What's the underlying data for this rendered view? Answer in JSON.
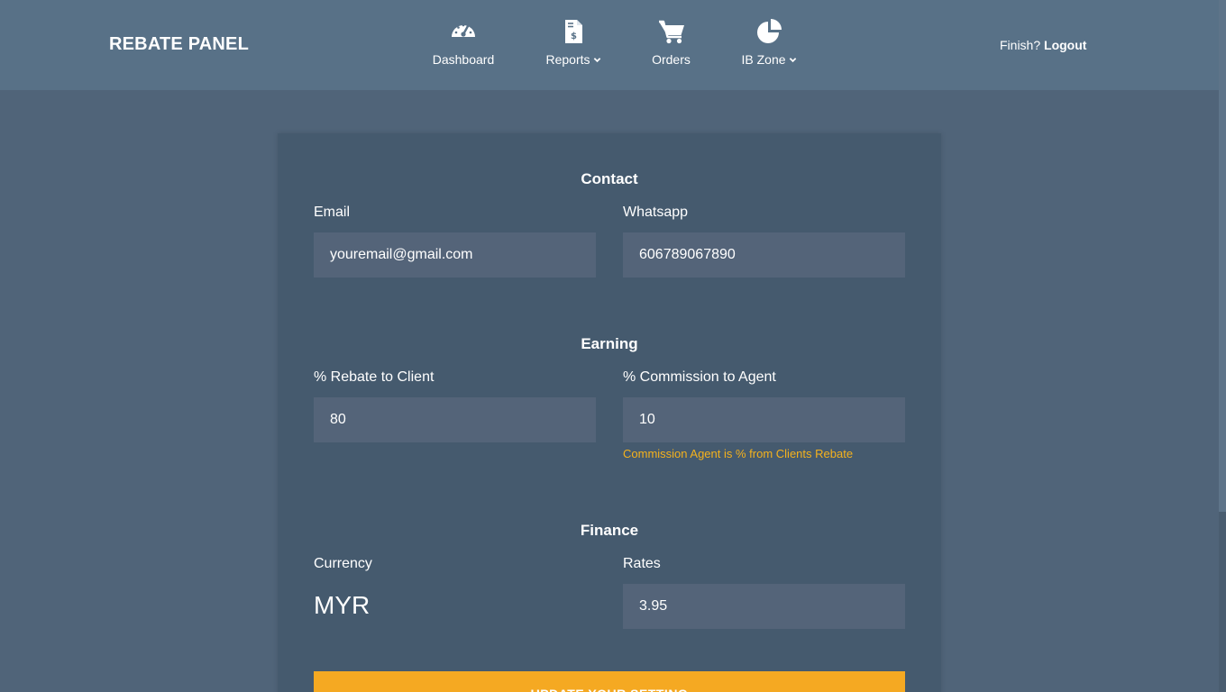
{
  "brand": "REBATE PANEL",
  "nav": {
    "dashboard": "Dashboard",
    "reports": "Reports",
    "orders": "Orders",
    "ib_zone": "IB Zone"
  },
  "logout_prompt": "Finish?",
  "logout_label": "Logout",
  "contact": {
    "title": "Contact",
    "email_label": "Email",
    "email_value": "youremail@gmail.com",
    "whatsapp_label": "Whatsapp",
    "whatsapp_value": "606789067890"
  },
  "earning": {
    "title": "Earning",
    "rebate_label": "% Rebate to Client",
    "rebate_value": "80",
    "commission_label": "% Commission to Agent",
    "commission_value": "10",
    "commission_hint": "Commission Agent is % from Clients Rebate"
  },
  "finance": {
    "title": "Finance",
    "currency_label": "Currency",
    "currency_value": "MYR",
    "rates_label": "Rates",
    "rates_value": "3.95"
  },
  "update_button": "UPDATE YOUR SETTING",
  "colors": {
    "page_bg": "#506479",
    "navbar_bg": "#587187",
    "card_bg": "#455a6e",
    "input_bg": "#546479",
    "accent": "#f5a922",
    "hint": "#f5b21d"
  },
  "icons": {
    "dashboard": "speedometer-icon",
    "reports": "invoice-icon",
    "orders": "cart-icon",
    "ib_zone": "pie-chart-icon",
    "dropdown": "chevron-down-icon"
  }
}
